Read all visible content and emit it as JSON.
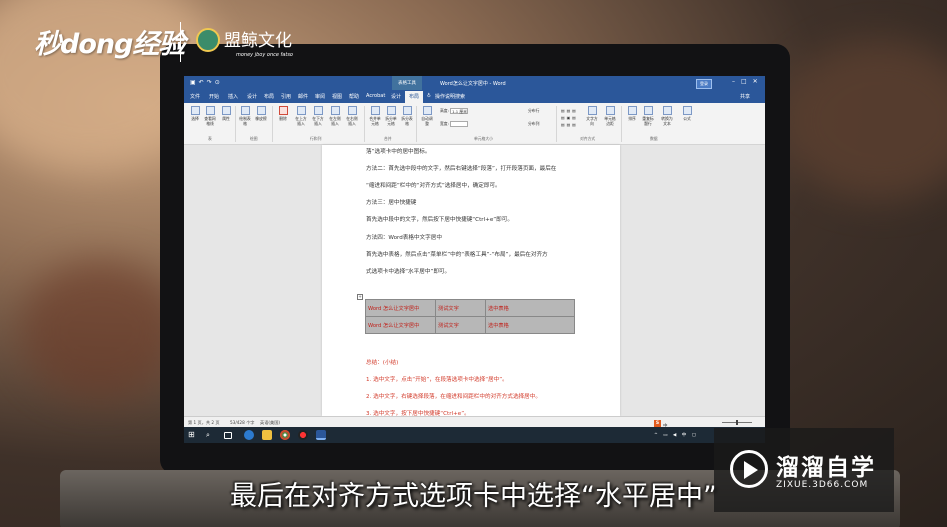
{
  "overlay": {
    "logo": "秒dong经验",
    "brand_name": "盟鲸文化",
    "brand_sub": "money   jboy   once   fatso",
    "subtitle": "最后在对齐方式选项卡中选择“水平居中”",
    "watermark_name": "溜溜自学",
    "watermark_url": "ZIXUE.3D66.COM"
  },
  "word": {
    "context_tab": "表格工具",
    "doc_title": "Word怎么让文字居中 - Word",
    "login": "登录",
    "share": "共享",
    "menu": [
      "文件",
      "开始",
      "插入",
      "设计",
      "布局",
      "引用",
      "邮件",
      "审阅",
      "视图",
      "帮助",
      "Acrobat",
      "设计",
      "布局"
    ],
    "active_menu": "布局",
    "tell_me": "操作说明搜索",
    "ribbon": {
      "buttons": [
        "选择",
        "查看网格线",
        "属性",
        "绘制表格",
        "橡皮擦",
        "删除",
        "在上方插入",
        "在下方插入",
        "在左侧插入",
        "在右侧插入",
        "合并单元格",
        "拆分单元格",
        "拆分表格",
        "自动调整",
        "文字方向",
        "单元格边距",
        "排序",
        "重复标题行",
        "转换为文本",
        "公式"
      ],
      "groups": [
        "表",
        "绘图",
        "行和列",
        "合并",
        "单元格大小",
        "对齐方式",
        "数据"
      ],
      "height_label": "高度:",
      "height_value": "1.1 厘米",
      "width_label": "宽度:",
      "distribute_rows": "分布行",
      "distribute_cols": "分布列"
    },
    "lines": [
      "落”选项卡中的居中图标。",
      "方法二：首先选中段中的文字，然后右键选择“段落”，打开段落页面，最后在",
      "“缩进和间距”栏中的“对齐方式”选择居中，确定即可。",
      "方法三：居中快捷键",
      "首先选中段中的文字，然后按下居中快捷键“Ctrl+e”即可。",
      "方法四：Word表格中文字居中",
      "首先选中表格，然后点击“菜单栏”中的“表格工具”-“布局”，最后在对齐方",
      "式选项卡中选择“水平居中”即可。"
    ],
    "table": [
      [
        "Word 怎么让文字居中",
        "测试文字",
        "选中表格"
      ],
      [
        "Word 怎么让文字居中",
        "测试文字",
        "选中表格"
      ]
    ],
    "red_lines": [
      "总结：(小结)",
      "1. 选中文字，点击“开始”，在段落选项卡中选择“居中”。",
      "2. 选中文字，右键选择段落，在缩进和间距栏中的对齐方式选择居中。",
      "3. 选中文字，按下居中快捷键“Ctrl+e”。"
    ],
    "status": {
      "page": "第 1 页，共 2 页",
      "words": "53/428 个字",
      "lang": "英语(美国)"
    },
    "ime": "中",
    "tray_text": "中"
  }
}
